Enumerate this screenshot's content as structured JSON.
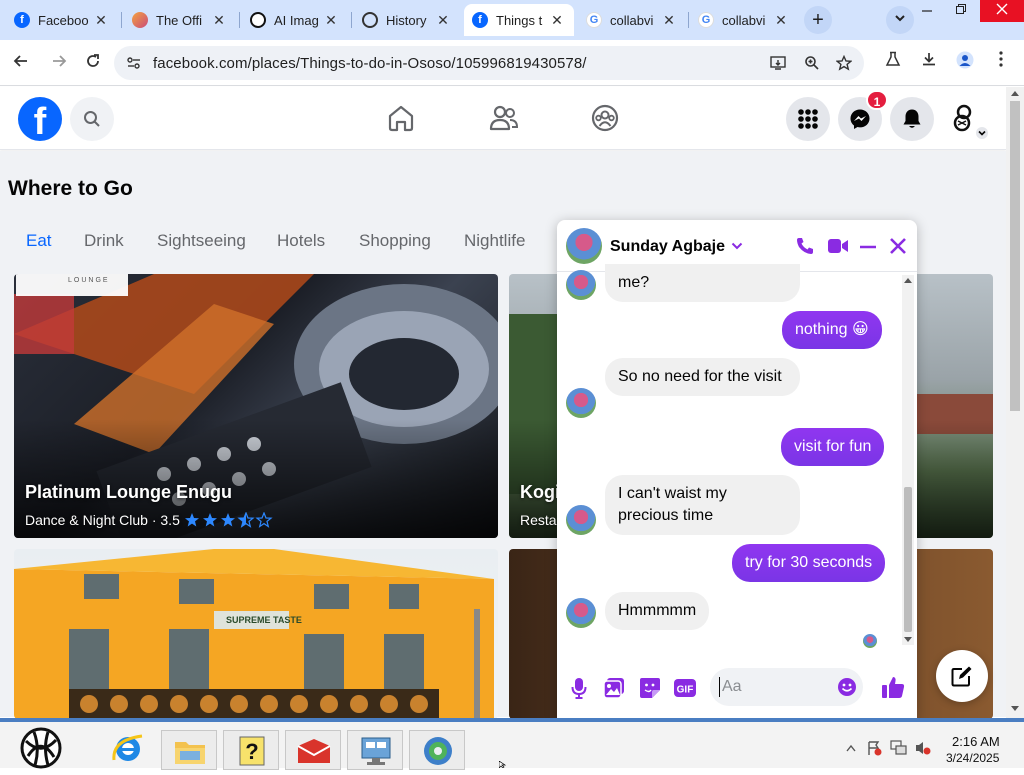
{
  "browser": {
    "tabs": [
      {
        "label": "Faceboo",
        "favicon": "facebook",
        "active": false
      },
      {
        "label": "The Offi",
        "favicon": "office",
        "active": false
      },
      {
        "label": "AI Imag",
        "favicon": "ai-image",
        "active": false
      },
      {
        "label": "History",
        "favicon": "history",
        "active": false
      },
      {
        "label": "Things t",
        "favicon": "facebook",
        "active": true
      },
      {
        "label": "collabvi",
        "favicon": "google",
        "active": false
      },
      {
        "label": "collabvi",
        "favicon": "google",
        "active": false
      }
    ],
    "tab_close_glyph": "✕",
    "new_tab_glyph": "+",
    "url": "facebook.com/places/Things-to-do-in-Ososo/105996819430578/"
  },
  "facebook": {
    "logo_letter": "f",
    "messenger_badge": "1",
    "page_title": "Where to Go",
    "categories": [
      "Eat",
      "Drink",
      "Sightseeing",
      "Hotels",
      "Shopping",
      "Nightlife"
    ],
    "active_category": "Eat",
    "cards": [
      {
        "title": "Platinum Lounge Enugu",
        "subtitle": "Dance & Night Club · 3.5",
        "rating": 3.5,
        "logo_text": "LOUNGE"
      },
      {
        "title": "Kogi",
        "subtitle": "Resta"
      },
      {
        "sign_text": "SUPREME TASTE"
      }
    ]
  },
  "chat": {
    "contact_name": "Sunday Agbaje",
    "messages": [
      {
        "from": "them",
        "text": "me?"
      },
      {
        "from": "me",
        "text": "nothing 😀"
      },
      {
        "from": "them",
        "text": "So no need for the visit"
      },
      {
        "from": "me",
        "text": "visit for fun"
      },
      {
        "from": "them",
        "text": "I can't waist my precious time"
      },
      {
        "from": "me",
        "text": "try for 30 seconds"
      },
      {
        "from": "them",
        "text": "Hmmmmm"
      }
    ],
    "input_placeholder": "Aa",
    "accent_color": "#8a2be2"
  },
  "taskbar": {
    "time": "2:16 AM",
    "date": "3/24/2025"
  },
  "colors": {
    "facebook_blue": "#0866ff",
    "messenger_purple": "#8a2be2",
    "notification_red": "#e41e3f"
  }
}
